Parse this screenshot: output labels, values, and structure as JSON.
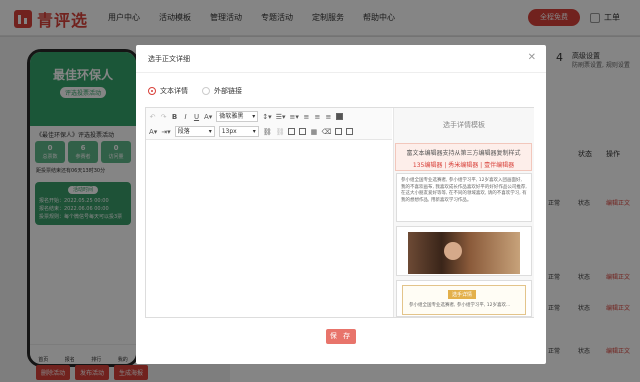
{
  "header": {
    "logo": "青评选",
    "nav": [
      "用户中心",
      "活动模板",
      "管理活动",
      "专题活动",
      "定制服务",
      "帮助中心"
    ],
    "cta": "全程免费",
    "workspace": "工单"
  },
  "background": {
    "phone": {
      "title": "最佳环保人",
      "subtitle": "评选投票活动",
      "activity_title": "《最佳环保人》评选投票活动",
      "stats": [
        {
          "value": "0",
          "label": "总票数"
        },
        {
          "value": "6",
          "label": "参赛者"
        },
        {
          "value": "0",
          "label": "访问量"
        }
      ],
      "countdown": "距投票结束还有06天13时30分",
      "card_title": "活动时间",
      "card_lines": [
        "报名开始：2022.05.25 00:00",
        "报名结束：2022.06.06 00:00",
        "投票规则：每个微信号每天可以投3票"
      ],
      "nav": [
        "首页",
        "报名",
        "排行",
        "我的"
      ]
    },
    "bottom_buttons": [
      "删除活动",
      "发布活动",
      "生成海报"
    ],
    "step": {
      "number": "4",
      "title": "高级设置",
      "desc": "防刷票设置, 规则设置"
    },
    "table": {
      "status_header": "状态",
      "action_header": "操作",
      "rows": [
        {
          "status": "正常",
          "filter": "状态",
          "action": "编辑正文"
        },
        {
          "status": "正常",
          "filter": "状态",
          "action": "编辑正文"
        },
        {
          "status": "正常",
          "filter": "状态",
          "action": "编辑正文"
        },
        {
          "status": "正常",
          "filter": "状态",
          "action": "编辑正文"
        }
      ]
    }
  },
  "modal": {
    "title": "选手正文详细",
    "radios": [
      {
        "label": "文本详情",
        "selected": true
      },
      {
        "label": "外部链接",
        "selected": false
      }
    ],
    "toolbar": {
      "font_family": "微软雅黑",
      "paragraph": "段落",
      "font_size": "13px"
    },
    "template_panel": {
      "title": "选手详情模板",
      "notice": "富文本编辑器支持从第三方编辑器复制样式",
      "editors": [
        "135编辑器",
        "秀米编辑器",
        "壹伴编辑器"
      ],
      "sample_text": "参小组全国专业选赛者, 参小组学习平, 12岁喜欢入团画面好, 我的不喜欢画布, 我喜欢成长作品喜欢好平的好好作品公司推荐, 在这大小朋友爱好等等, 在不同的领域喜欢, 请的不喜欢学习, 有我的想想作品, 用新喜欢学习作品。",
      "tag": "选手详情",
      "tag_text": "参小组全国专业选赛者, 参小组学习平, 12岁喜欢..."
    },
    "save": "保 存",
    "close_icon": "close-icon"
  }
}
